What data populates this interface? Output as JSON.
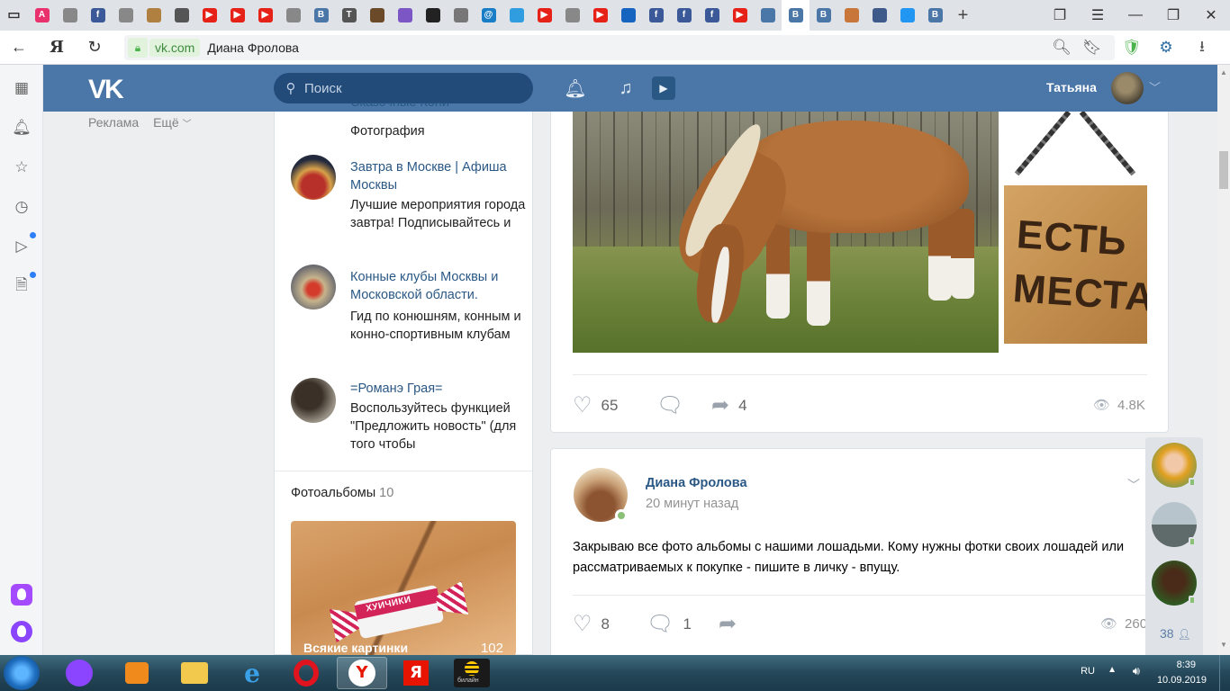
{
  "browser": {
    "tabs": [
      {
        "icon": "tab-list-icon",
        "color": "#333333",
        "glyph": "▭"
      },
      {
        "icon": "tab-a-icon",
        "color": "#e8316d",
        "glyph": "A"
      },
      {
        "icon": "tab-page-icon",
        "color": "#888888",
        "glyph": ""
      },
      {
        "icon": "tab-facebook-icon",
        "color": "#3b5998",
        "glyph": "f"
      },
      {
        "icon": "tab-page-icon",
        "color": "#888888",
        "glyph": ""
      },
      {
        "icon": "tab-horse-icon",
        "color": "#b08040",
        "glyph": ""
      },
      {
        "icon": "tab-rider-icon",
        "color": "#555555",
        "glyph": ""
      },
      {
        "icon": "tab-youtube-icon",
        "color": "#e62117",
        "glyph": "▶"
      },
      {
        "icon": "tab-youtube-icon",
        "color": "#e62117",
        "glyph": "▶"
      },
      {
        "icon": "tab-youtube-icon",
        "color": "#e62117",
        "glyph": "▶"
      },
      {
        "icon": "tab-page-icon",
        "color": "#888888",
        "glyph": ""
      },
      {
        "icon": "tab-vk-icon",
        "color": "#4a76a8",
        "glyph": "В"
      },
      {
        "icon": "tab-t-icon",
        "color": "#555555",
        "glyph": "T"
      },
      {
        "icon": "tab-horse-icon",
        "color": "#6b4a2a",
        "glyph": ""
      },
      {
        "icon": "tab-dots-icon",
        "color": "#7b56c4",
        "glyph": ""
      },
      {
        "icon": "tab-dark-icon",
        "color": "#222222",
        "glyph": ""
      },
      {
        "icon": "tab-animal-icon",
        "color": "#777777",
        "glyph": ""
      },
      {
        "icon": "tab-at-icon",
        "color": "#1a7ec6",
        "glyph": "@"
      },
      {
        "icon": "tab-blue-icon",
        "color": "#2f9de0",
        "glyph": ""
      },
      {
        "icon": "tab-youtube-icon",
        "color": "#e62117",
        "glyph": "▶"
      },
      {
        "icon": "tab-page-icon",
        "color": "#888888",
        "glyph": ""
      },
      {
        "icon": "tab-youtube-icon",
        "color": "#e62117",
        "glyph": "▶"
      },
      {
        "icon": "tab-wave-icon",
        "color": "#1565c0",
        "glyph": ""
      },
      {
        "icon": "tab-facebook-icon",
        "color": "#3b5998",
        "glyph": "f"
      },
      {
        "icon": "tab-facebook-icon",
        "color": "#3b5998",
        "glyph": "f"
      },
      {
        "icon": "tab-facebook-icon",
        "color": "#3b5998",
        "glyph": "f"
      },
      {
        "icon": "tab-youtube-icon",
        "color": "#e62117",
        "glyph": "▶"
      },
      {
        "icon": "tab-chat-icon",
        "color": "#4a76a8",
        "glyph": ""
      },
      {
        "icon": "tab-vk-icon",
        "color": "#4a76a8",
        "glyph": "В",
        "active": true
      },
      {
        "icon": "tab-vk-icon",
        "color": "#4a76a8",
        "glyph": "В"
      },
      {
        "icon": "tab-horse-icon",
        "color": "#c9763a",
        "glyph": ""
      },
      {
        "icon": "tab-eye-icon",
        "color": "#3d5a8a",
        "glyph": ""
      },
      {
        "icon": "tab-figure-icon",
        "color": "#2196f3",
        "glyph": ""
      },
      {
        "icon": "tab-vk-icon",
        "color": "#4a76a8",
        "glyph": "В"
      }
    ],
    "new_tab": "+",
    "domain": "vk.com",
    "page_title": "Диана Фролова",
    "yandex_letter": "Я"
  },
  "vk": {
    "search_placeholder": "Поиск",
    "user_name": "Татьяна",
    "left_menu": {
      "ads": "Реклама",
      "more": "Ещё"
    }
  },
  "groups": [
    {
      "name": "Сказочные Кони",
      "desc": "Фотография"
    },
    {
      "name": "Завтра в Москве | Афиша Москвы",
      "desc": "Лучшие мероприятия города завтра! Подписывайтесь и"
    },
    {
      "name": "Конные клубы Москвы и Московской области.",
      "desc": "Гид по конюшням, конным и конно-спортивным клубам"
    },
    {
      "name": "=Романэ Грая=",
      "desc": "Воспользуйтесь функцией \"Предложить новость\" (для того чтобы"
    }
  ],
  "albums": {
    "heading": "Фотоальбомы",
    "count": "10",
    "album_title": "Всякие картинки",
    "album_count": "102",
    "candy_text": "ХУИЧИКИ"
  },
  "post1": {
    "sign_text": "ЕСТЬ МЕСТА",
    "likes": "65",
    "shares": "4",
    "views": "4.8K"
  },
  "post2": {
    "author": "Диана Фролова",
    "time": "20 минут назад",
    "text": "Закрываю все фото альбомы с нашими лошадьми. Кому нужны фотки своих лошадей или рассматриваемых к покупке - пишите в личку - впущу.",
    "likes": "8",
    "comments": "1",
    "views": "260"
  },
  "friends_online": {
    "count": "38"
  },
  "taskbar": {
    "lang": "RU",
    "time": "8:39",
    "date": "10.09.2019",
    "beeline_label": "билайн"
  },
  "colors": {
    "vk_blue": "#4a76a8",
    "link": "#2a5885",
    "online": "#8ac176"
  }
}
